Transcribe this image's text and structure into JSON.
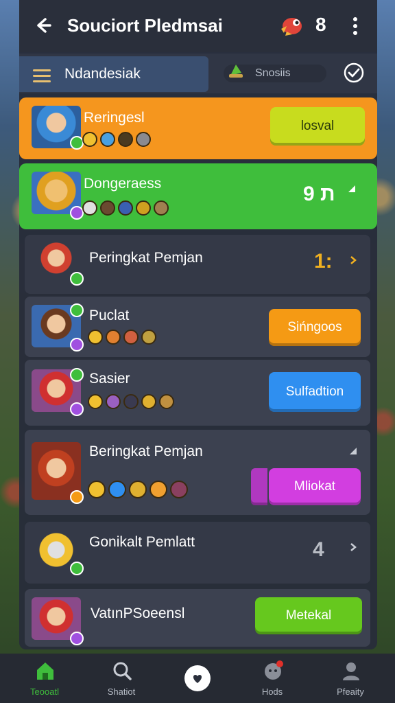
{
  "header": {
    "title": "Souciort Pledmsai",
    "notification_count": "8"
  },
  "subbar": {
    "tab_label": "Ndandesiak",
    "search_placeholder": "Snosiis"
  },
  "rows": [
    {
      "name": "Reringesl",
      "button": "losval"
    },
    {
      "name": "Dongeraess",
      "rank": "9 ת"
    },
    {
      "name": "Peringkat Pemjan",
      "rank": "1:"
    },
    {
      "name": "Puclat",
      "button": "Sińngoos"
    },
    {
      "name": "Sasier",
      "button": "Sulfadtion"
    },
    {
      "name": "Beringkat Pemjan",
      "button": "Mliokat"
    },
    {
      "name": "Gonikalt Pemlatt",
      "rank": "4"
    },
    {
      "name": "VatınPSoeensl",
      "button": "Metekal"
    }
  ],
  "bottom_nav": [
    {
      "label": "Teooatl",
      "icon": "home-icon"
    },
    {
      "label": "Shatiot",
      "icon": "magnifier-icon"
    },
    {
      "label": "",
      "icon": "heart-icon"
    },
    {
      "label": "Hods",
      "icon": "chat-icon"
    },
    {
      "label": "Pfeaity",
      "icon": "profile-icon"
    }
  ],
  "colors": {
    "orange_highlight": "#f5961e",
    "green_highlight": "#3fbe3c",
    "yellow_button": "#c8dc1e",
    "orange_button": "#f59a14",
    "blue_button": "#2f8ff0",
    "magenta_button": "#d23ee0",
    "green_button": "#66c81e"
  }
}
